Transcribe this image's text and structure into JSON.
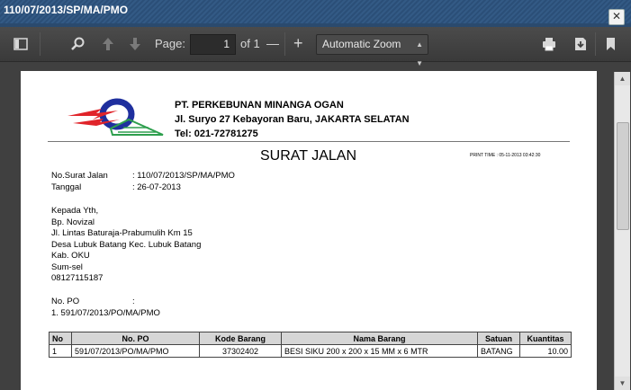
{
  "window": {
    "title": "110/07/2013/SP/MA/PMO",
    "close_symbol": "✕"
  },
  "toolbar": {
    "page_label": "Page:",
    "page_value": "1",
    "page_count": "of 1",
    "zoom_minus": "—",
    "zoom_plus": "+",
    "zoom_value": "Automatic Zoom"
  },
  "company": {
    "name": "PT. PERKEBUNAN MINANGA OGAN",
    "address": "Jl. Suryo 27 Kebayoran Baru, JAKARTA SELATAN",
    "tel": "Tel: 021-72781275"
  },
  "document": {
    "title": "SURAT JALAN",
    "print_time": "PRINT TIME : 05-11-2013 03:42:30",
    "no_label": "No.Surat Jalan",
    "no_value": ": 110/07/2013/SP/MA/PMO",
    "date_label": "Tanggal",
    "date_value": ": 26-07-2013",
    "recipient": [
      "Kepada Yth,",
      "Bp. Novizal",
      "Jl. Lintas Baturaja-Prabumulih Km 15",
      "Desa Lubuk Batang Kec. Lubuk Batang",
      "Kab. OKU",
      "Sum-sel",
      "08127115187"
    ],
    "po_label": "No. PO",
    "po_colon": ":",
    "po_item": "1.   591/07/2013/PO/MA/PMO"
  },
  "table": {
    "headers": [
      "No",
      "No. PO",
      "Kode Barang",
      "Nama Barang",
      "Satuan",
      "Kuantitas"
    ],
    "rows": [
      [
        "1",
        "591/07/2013/PO/MA/PMO",
        "37302402",
        "BESI SIKU 200 x 200 x 15 MM x 6 MTR",
        "BATANG",
        "10.00"
      ]
    ]
  },
  "colors": {
    "logo_blue": "#1f2f9e",
    "logo_red": "#e0242a",
    "logo_green": "#2e9f4e"
  }
}
